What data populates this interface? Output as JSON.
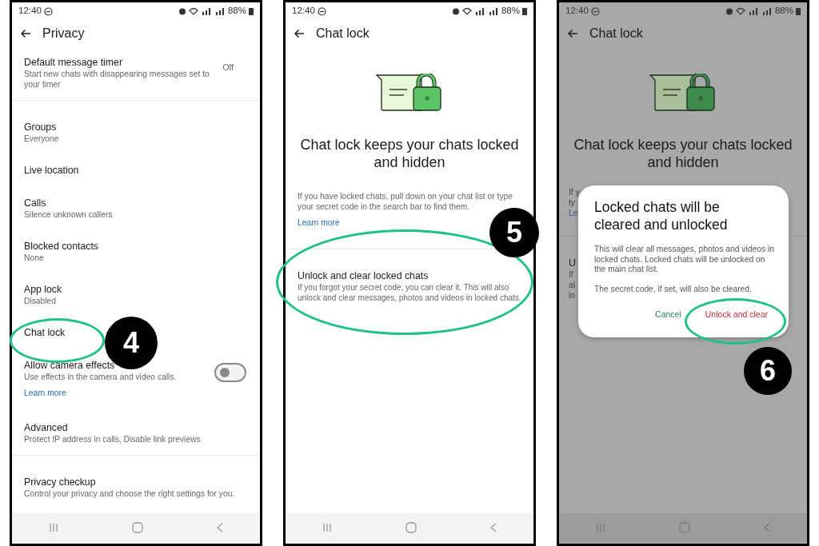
{
  "screens": [
    {
      "kind": "settings",
      "status_bar": {
        "time": "12:40",
        "battery": "88%"
      },
      "title": "Privacy",
      "sections": [
        [
          {
            "kind": "row",
            "title": "Default message timer",
            "subtitle": "Start new chats with disappearing messages set to your timer",
            "value": "Off"
          }
        ],
        [
          {
            "kind": "row",
            "title": "Groups",
            "subtitle": "Everyone"
          },
          {
            "kind": "row",
            "title": "Live location"
          },
          {
            "kind": "row",
            "title": "Calls",
            "subtitle": "Silence unknown callers"
          },
          {
            "kind": "row",
            "title": "Blocked contacts",
            "subtitle": "None"
          },
          {
            "kind": "row",
            "title": "App lock",
            "subtitle": "Disabled"
          },
          {
            "kind": "row",
            "title": "Chat lock"
          },
          {
            "kind": "toggle",
            "title": "Allow camera effects",
            "subtitle": "Use effects in the camera and video calls.",
            "link": "Learn more",
            "on": false
          },
          {
            "kind": "row",
            "title": "Advanced",
            "subtitle": "Protect IP address in calls, Disable link previews"
          }
        ],
        [
          {
            "kind": "row",
            "title": "Privacy checkup",
            "subtitle": "Control your privacy and choose the right settings for you."
          }
        ]
      ],
      "annotation": {
        "number": "4"
      }
    },
    {
      "kind": "chat_lock",
      "status_bar": {
        "time": "12:40",
        "battery": "88%"
      },
      "title": "Chat lock",
      "headline": "Chat lock keeps your chats locked and hidden",
      "info": "If you have locked chats, pull down on your chat list or type your secret code in the search bar to find them.",
      "link": "Learn more",
      "option": {
        "title": "Unlock and clear locked chats",
        "subtitle": "If you forgot your secret code, you can clear it. This will also unlock and clear messages, photos and videos in locked chats."
      },
      "annotation": {
        "number": "5"
      }
    },
    {
      "kind": "dialog",
      "status_bar": {
        "time": "12:40",
        "battery": "88%"
      },
      "title": "Chat lock",
      "headline": "Chat lock keeps your chats locked and hidden",
      "info_fragments": [
        "If y",
        "ty"
      ],
      "link_fragment": "Le",
      "option_fragment": "U",
      "subtitle_fragments": [
        "If",
        "al",
        "lo"
      ],
      "dialog": {
        "title": "Locked chats will be cleared and unlocked",
        "body": "This will clear all messages, photos and videos in locked chats. Locked chats will be unlocked on the main chat list.",
        "note": "The secret code, if set, will also be cleared.",
        "cancel": "Cancel",
        "confirm": "Unlock and clear"
      },
      "annotation": {
        "number": "6"
      }
    }
  ]
}
